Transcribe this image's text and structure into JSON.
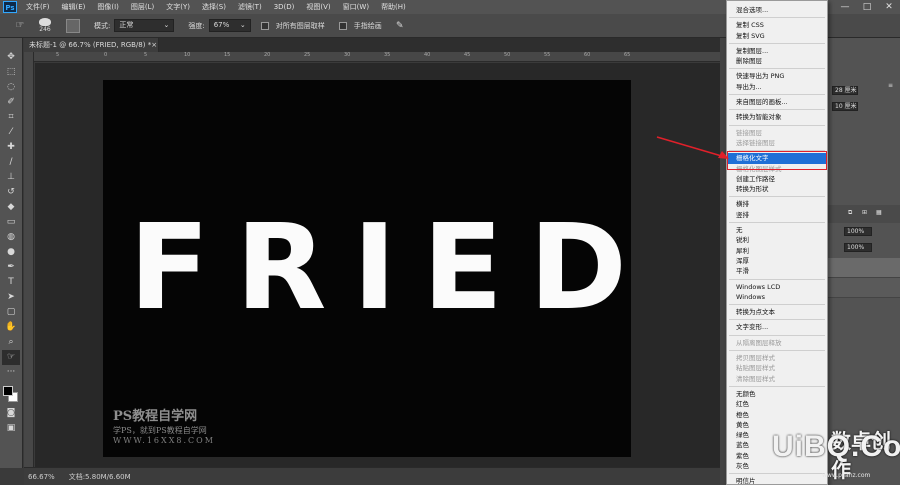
{
  "menubar": {
    "logo": "Ps",
    "items": [
      "文件(F)",
      "编辑(E)",
      "图像(I)",
      "图层(L)",
      "文字(Y)",
      "选择(S)",
      "滤镜(T)",
      "3D(D)",
      "视图(V)",
      "窗口(W)",
      "帮助(H)"
    ],
    "window_controls": [
      "—",
      "□",
      "✕"
    ]
  },
  "options": {
    "brush_size": "246",
    "mode_label": "模式:",
    "mode_value": "正常",
    "strength_label": "强度:",
    "strength_value": "67%",
    "sample_all_label": "对所有图层取样",
    "finger_paint_label": "手指绘画"
  },
  "document": {
    "tab_title": "未标题-1 @ 66.7% (FRIED, RGB/8) *",
    "close": "×",
    "ruler_ticks": [
      "5",
      "0",
      "5",
      "10",
      "15",
      "20",
      "25",
      "30",
      "35",
      "40",
      "45",
      "50",
      "55",
      "60",
      "65"
    ],
    "canvas_text": "FRIED",
    "watermark": {
      "line1": "PS教程自学网",
      "line2": "学PS，就到PS教程自学网",
      "line3": "WWW.16XX8.COM"
    }
  },
  "status": {
    "zoom": "66.67%",
    "doc_size": "文档:5.80M/6.60M"
  },
  "dock": {
    "unit_1": "28 厘米",
    "unit_2": "10 厘米",
    "opacity_1": "100%",
    "opacity_2": "100%"
  },
  "context_menu": {
    "items": [
      {
        "label": "混合选项...",
        "state": "normal"
      },
      {
        "sep": true
      },
      {
        "label": "复制 CSS",
        "state": "normal"
      },
      {
        "label": "复制 SVG",
        "state": "normal"
      },
      {
        "sep": true
      },
      {
        "label": "复制图层...",
        "state": "normal"
      },
      {
        "label": "删除图层",
        "state": "normal"
      },
      {
        "sep": true
      },
      {
        "label": "快速导出为 PNG",
        "state": "normal"
      },
      {
        "label": "导出为...",
        "state": "normal"
      },
      {
        "sep": true
      },
      {
        "label": "来自图层的画板...",
        "state": "normal"
      },
      {
        "sep": true
      },
      {
        "label": "转换为智能对象",
        "state": "normal"
      },
      {
        "sep": true
      },
      {
        "label": "链接图层",
        "state": "disabled"
      },
      {
        "label": "选择链接图层",
        "state": "disabled"
      },
      {
        "sep": true
      },
      {
        "label": "栅格化文字",
        "state": "highlighted"
      },
      {
        "label": "栅格化图层样式",
        "state": "disabled"
      },
      {
        "label": "创建工作路径",
        "state": "normal"
      },
      {
        "label": "转换为形状",
        "state": "normal"
      },
      {
        "sep": true
      },
      {
        "label": "横排",
        "state": "normal"
      },
      {
        "label": "竖排",
        "state": "normal"
      },
      {
        "sep": true
      },
      {
        "label": "无",
        "state": "normal"
      },
      {
        "label": "锐利",
        "state": "normal"
      },
      {
        "label": "犀利",
        "state": "normal"
      },
      {
        "label": "浑厚",
        "state": "normal"
      },
      {
        "label": "平滑",
        "state": "normal"
      },
      {
        "sep": true
      },
      {
        "label": "Windows LCD",
        "state": "normal"
      },
      {
        "label": "Windows",
        "state": "normal"
      },
      {
        "sep": true
      },
      {
        "label": "转换为点文本",
        "state": "normal"
      },
      {
        "sep": true
      },
      {
        "label": "文字变形...",
        "state": "normal"
      },
      {
        "sep": true
      },
      {
        "label": "从隔离图层释放",
        "state": "disabled"
      },
      {
        "sep": true
      },
      {
        "label": "拷贝图层样式",
        "state": "disabled"
      },
      {
        "label": "粘贴图层样式",
        "state": "disabled"
      },
      {
        "label": "清除图层样式",
        "state": "disabled"
      },
      {
        "sep": true
      },
      {
        "label": "无颜色",
        "state": "normal"
      },
      {
        "label": "红色",
        "state": "normal"
      },
      {
        "label": "橙色",
        "state": "normal"
      },
      {
        "label": "黄色",
        "state": "normal"
      },
      {
        "label": "绿色",
        "state": "normal"
      },
      {
        "label": "蓝色",
        "state": "normal"
      },
      {
        "label": "紫色",
        "state": "normal"
      },
      {
        "label": "灰色",
        "state": "normal"
      },
      {
        "sep": true
      },
      {
        "label": "明信片",
        "state": "normal"
      }
    ]
  },
  "overlay": {
    "wechat_text": "数卓创作",
    "brand": "UiBQ.CoM",
    "brand_sub": "www.psahz.com"
  },
  "colors": {
    "highlight": "#1f6fd6",
    "annotation_red": "#e0202a"
  }
}
